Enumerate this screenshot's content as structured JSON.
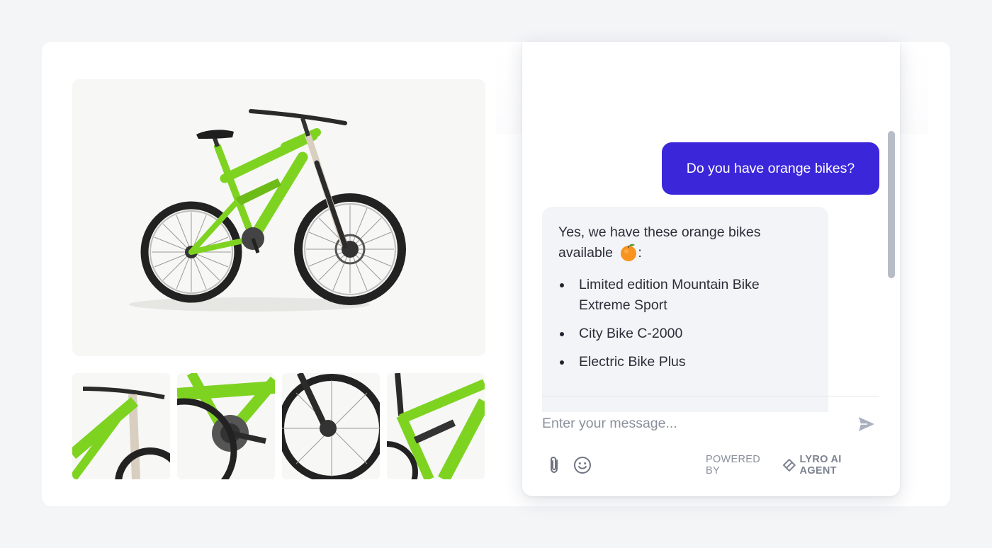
{
  "product": {
    "main_image": "green-mountain-bike",
    "thumbnails": [
      "handlebar-closeup",
      "crankset-closeup",
      "front-wheel-closeup",
      "rear-shock-closeup"
    ],
    "accent_color": "#7ed321"
  },
  "chat": {
    "user_message": "Do you have orange bikes?",
    "bot_intro": "Yes, we have these orange bikes available",
    "bot_intro_suffix": ":",
    "bot_emoji": "orange-emoji",
    "bot_items": [
      "Limited edition Mountain Bike Extreme Sport",
      "City Bike C-2000",
      "Electric Bike Plus"
    ],
    "input_placeholder": "Enter your message...",
    "powered_by": "POWERED BY",
    "brand": "LYRO AI AGENT",
    "colors": {
      "user_bubble": "#3b26da",
      "bot_bubble": "#f3f4f7"
    }
  }
}
